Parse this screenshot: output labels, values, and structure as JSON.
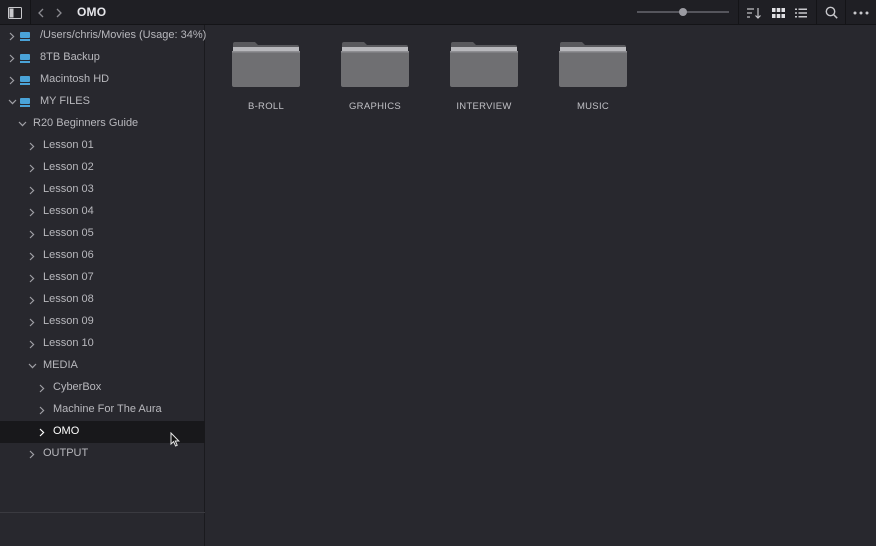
{
  "toolbar": {
    "title": "OMO",
    "zoom": 0.5,
    "icons": [
      "sidebar-toggle-icon",
      "back-icon",
      "forward-icon",
      "sort-icon",
      "grid-view-icon",
      "list-view-icon",
      "search-icon",
      "more-icon"
    ]
  },
  "sidebar": {
    "items": [
      {
        "label": "/Users/chris/Movies (Usage: 34%)",
        "type": "drive",
        "expanded": false
      },
      {
        "label": "8TB Backup",
        "type": "drive",
        "expanded": false
      },
      {
        "label": "Macintosh HD",
        "type": "drive",
        "expanded": false
      },
      {
        "label": "MY FILES",
        "type": "drive",
        "expanded": true
      },
      {
        "label": "R20 Beginners Guide",
        "type": "folder",
        "expanded": true
      },
      {
        "label": "Lesson 01",
        "type": "folder",
        "expanded": false
      },
      {
        "label": "Lesson 02",
        "type": "folder",
        "expanded": false
      },
      {
        "label": "Lesson 03",
        "type": "folder",
        "expanded": false
      },
      {
        "label": "Lesson 04",
        "type": "folder",
        "expanded": false
      },
      {
        "label": "Lesson 05",
        "type": "folder",
        "expanded": false
      },
      {
        "label": "Lesson 06",
        "type": "folder",
        "expanded": false
      },
      {
        "label": "Lesson 07",
        "type": "folder",
        "expanded": false
      },
      {
        "label": "Lesson 08",
        "type": "folder",
        "expanded": false
      },
      {
        "label": "Lesson 09",
        "type": "folder",
        "expanded": false
      },
      {
        "label": "Lesson 10",
        "type": "folder",
        "expanded": false
      },
      {
        "label": "MEDIA",
        "type": "folder",
        "expanded": true
      },
      {
        "label": "CyberBox",
        "type": "folder",
        "expanded": false
      },
      {
        "label": "Machine For The Aura",
        "type": "folder",
        "expanded": false
      },
      {
        "label": "OMO",
        "type": "folder",
        "expanded": false,
        "selected": true
      },
      {
        "label": "OUTPUT",
        "type": "folder",
        "expanded": false
      }
    ]
  },
  "main": {
    "folders": [
      {
        "label": "B-ROLL"
      },
      {
        "label": "GRAPHICS"
      },
      {
        "label": "INTERVIEW"
      },
      {
        "label": "MUSIC"
      }
    ]
  },
  "colors": {
    "background": "#28282e",
    "toolbar": "#1f1f24",
    "selected_row": "#18181b",
    "drive_icon": "#4aa3d8",
    "folder_icon": "#6f6f72"
  }
}
